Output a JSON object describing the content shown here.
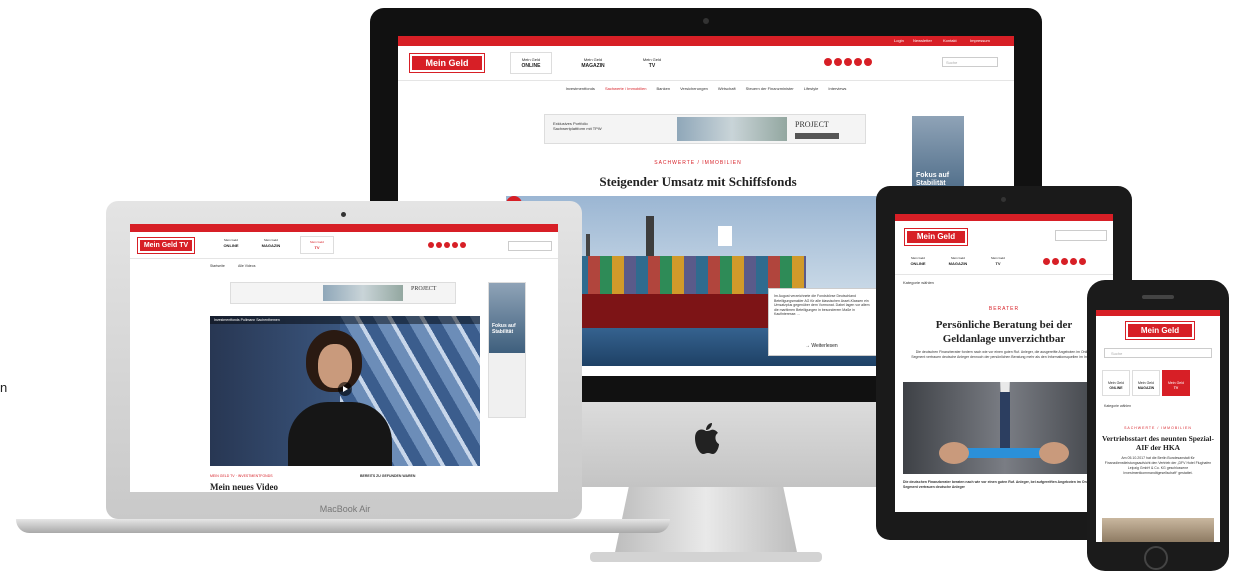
{
  "side_text": "n",
  "imac": {
    "logo": "Mein Geld",
    "top_links": [
      "Login",
      "Newsletter",
      "Kontakt",
      "Impressum"
    ],
    "tabs": [
      {
        "line1": "Mein Geld",
        "line2": "ONLINE"
      },
      {
        "line1": "Mein Geld",
        "line2": "MAGAZIN"
      },
      {
        "line1": "Mein Geld",
        "line2": "TV"
      }
    ],
    "search_placeholder": "Suche",
    "nav": [
      "Investmentfonds",
      "Sachwerte / Immobilien",
      "Banken",
      "Versicherungen",
      "Wirtschaft",
      "Steuern der Finanzminister",
      "Lifestyle",
      "Interviews"
    ],
    "banner_text": "Exklusives Portfolio Sachwertplattform mit TPW",
    "banner_brand": "PROJECT",
    "kicker": "SACHWERTE / IMMOBILIEN",
    "headline": "Steigender Umsatz mit Schiffsfonds",
    "sidebar_ad_title": "Fokus auf Stabilität",
    "article_box_text": "Im August verzeichnete die Fondsbörse Deutschland Beteiligungsmakler AG für alle klassischen Asset-Klassen ein Umsatzplus gegenüber dem Vormonat. Dabei lagen vor allem die maritimen Beteiligungen in besonderem Maße in Kaufinteresse. ...",
    "read_more": "→ Weiterlesen"
  },
  "macbook": {
    "logo": "Mein Geld TV",
    "tabs": [
      {
        "line1": "Mein Geld",
        "line2": "ONLINE"
      },
      {
        "line1": "Mein Geld",
        "line2": "MAGAZIN"
      },
      {
        "line1": "Mein Geld",
        "line2": "TV"
      }
    ],
    "nav": [
      "Startseite",
      "Alle Videos"
    ],
    "video_caption": "Investmentfonds Pullmann Sachenthemen",
    "video_kicker": "MEIN GELD TV · INVESTMENTFONDS",
    "video_title": "Mein neues Video",
    "side_heading": "BEREITS ZU GEFUNDEN WAREN",
    "sidebar_ad_title": "Fokus auf Stabilität",
    "banner_brand": "PROJECT",
    "brand_label": "MacBook Air"
  },
  "ipad": {
    "logo": "Mein Geld",
    "tabs": [
      {
        "line1": "Mein Geld",
        "line2": "ONLINE"
      },
      {
        "line1": "Mein Geld",
        "line2": "MAGAZIN"
      },
      {
        "line1": "Mein Geld",
        "line2": "TV"
      }
    ],
    "categories": "Kategorie wählen",
    "kicker": "BERATER",
    "headline": "Persönliche Beratung bei der Geldanlage unverzichtbar",
    "intro": "Die deutschen Finanzberater fordern nach wie vor einen guten Ruf. Anleger, die ausgereifte Angeboten im Online-Segment vertrauen deutsche Anleger dennoch der persönlichen Beratung mehr als den Informationsquellen im Internet.",
    "body": "Die deutschen Finanzberater beraten nach wie vor einen guten Ruf. Anleger, bei aufgereiften Angeboten im Online-Segment vertrauen deutsche Anleger"
  },
  "iphone": {
    "logo": "Mein Geld",
    "search_placeholder": "Suche",
    "tabs": [
      {
        "line1": "Mein Geld",
        "line2": "ONLINE"
      },
      {
        "line1": "Mein Geld",
        "line2": "MAGAZIN"
      },
      {
        "line1": "Mein Geld",
        "line2": "TV"
      }
    ],
    "categories": "Kategorie wählen",
    "kicker": "SACHWERTE / IMMOBILIEN",
    "headline": "Vertriebsstart des neunten Spezial-AIF der HKA",
    "body": "Am 05.10.2017 hat die Berlin Bundesanstalt für Finanzdienstleistungsaufsicht den Vertrieb der „DFV Hotel Flughafen Leipzig GmbH & Co. KG geschlossene Investmentkommanditgesellschaft“ gestattet."
  },
  "colors": {
    "brand_red": "#d71f26",
    "dark": "#222222"
  }
}
